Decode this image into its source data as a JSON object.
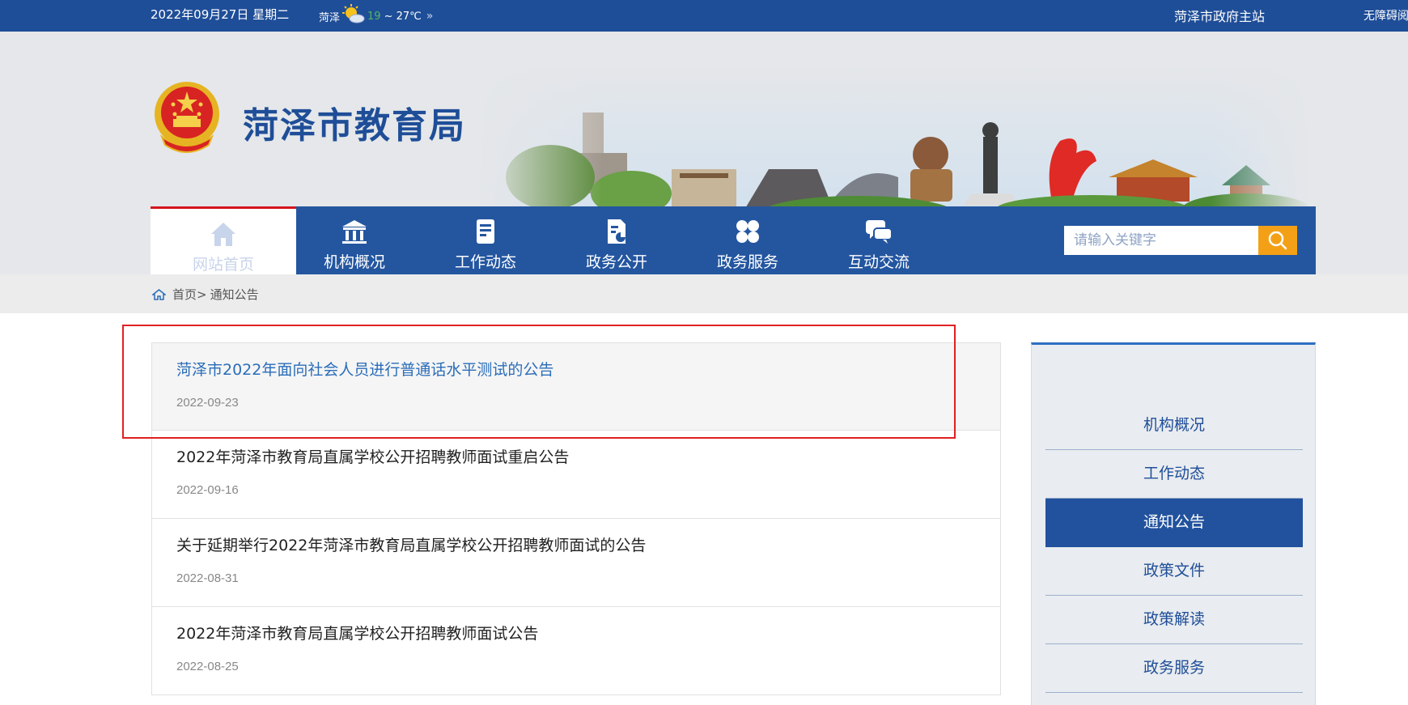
{
  "topbar": {
    "date": "2022年09月27日 星期二",
    "weather_city": "菏泽",
    "weather_low": "19",
    "weather_high": "~ 27℃",
    "weather_more": "»",
    "gov_link": "菏泽市政府主站",
    "accessibility_link": "无障碍阅"
  },
  "header": {
    "site_title": "菏泽市教育局"
  },
  "nav": {
    "items": [
      {
        "label": "网站首页",
        "icon": "home-icon"
      },
      {
        "label": "机构概况",
        "icon": "institution-icon"
      },
      {
        "label": "工作动态",
        "icon": "document-icon"
      },
      {
        "label": "政务公开",
        "icon": "file-chart-icon"
      },
      {
        "label": "政务服务",
        "icon": "grid-icon"
      },
      {
        "label": "互动交流",
        "icon": "chat-icon"
      }
    ],
    "active_index": 0,
    "search_placeholder": "请输入关键字"
  },
  "breadcrumb": {
    "home": "首页",
    "separator": ">",
    "current": "通知公告"
  },
  "articles": [
    {
      "title": "菏泽市2022年面向社会人员进行普通话水平测试的公告",
      "date": "2022-09-23"
    },
    {
      "title": "2022年菏泽市教育局直属学校公开招聘教师面试重启公告",
      "date": "2022-09-16"
    },
    {
      "title": "关于延期举行2022年菏泽市教育局直属学校公开招聘教师面试的公告",
      "date": "2022-08-31"
    },
    {
      "title": "2022年菏泽市教育局直属学校公开招聘教师面试公告",
      "date": "2022-08-25"
    }
  ],
  "sidebar": {
    "items": [
      "机构概况",
      "工作动态",
      "通知公告",
      "政策文件",
      "政策解读",
      "政务服务"
    ],
    "active_index": 2
  },
  "colors": {
    "primary_blue": "#1f4e98",
    "nav_blue": "#2456a0",
    "search_orange": "#f4a017",
    "highlight_red": "#e02020",
    "active_border_red": "#d4141b",
    "link_blue": "#2a6db9"
  }
}
